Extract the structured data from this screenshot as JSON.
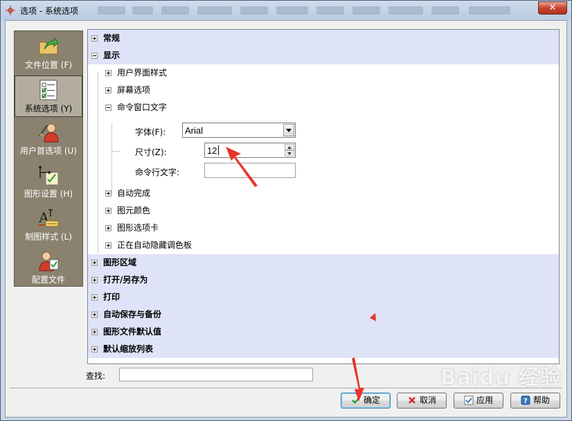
{
  "window": {
    "title": "选项 - 系统选项",
    "close_label": "✕"
  },
  "nav": {
    "items": [
      {
        "label": "文件位置 (F)",
        "icon": "folder-arrow-icon",
        "active": false
      },
      {
        "label": "系统选项 (Y)",
        "icon": "checklist-icon",
        "active": true
      },
      {
        "label": "用户首选项 (U)",
        "icon": "user-preferences-icon",
        "active": false
      },
      {
        "label": "图形设置 (H)",
        "icon": "drawing-settings-icon",
        "active": false
      },
      {
        "label": "制图样式 (L)",
        "icon": "text-style-icon",
        "active": false
      },
      {
        "label": "配置文件",
        "icon": "profile-user-icon",
        "active": false
      }
    ]
  },
  "tree": {
    "general": "常规",
    "display": "显示",
    "ui_style": "用户界面样式",
    "screen_options": "屏幕选项",
    "cmd_window_text": "命令窗口文字",
    "font_label": "字体(F):",
    "font_value": "Arial",
    "size_label": "尺寸(Z):",
    "size_value": "12",
    "cmdline_text_label": "命令行文字:",
    "cmdline_text_value": "",
    "auto_complete": "自动完成",
    "element_color": "图元颜色",
    "graphic_tab": "图形选项卡",
    "auto_hide_palette": "正在自动隐藏调色板",
    "graphic_area": "图形区域",
    "open_save_as": "打开/另存为",
    "print": "打印",
    "auto_save_backup": "自动保存与备份",
    "graphic_defaults": "图形文件默认值",
    "default_zoom_list": "默认缩放列表"
  },
  "search": {
    "label": "查找:",
    "value": ""
  },
  "buttons": {
    "ok": "确定",
    "cancel": "取消",
    "apply": "应用",
    "help": "帮助"
  },
  "watermark": "Baidu 经验",
  "colors": {
    "band": "#dfe3f8",
    "nav_bg": "#8a826f",
    "arrow": "#e8352a"
  }
}
